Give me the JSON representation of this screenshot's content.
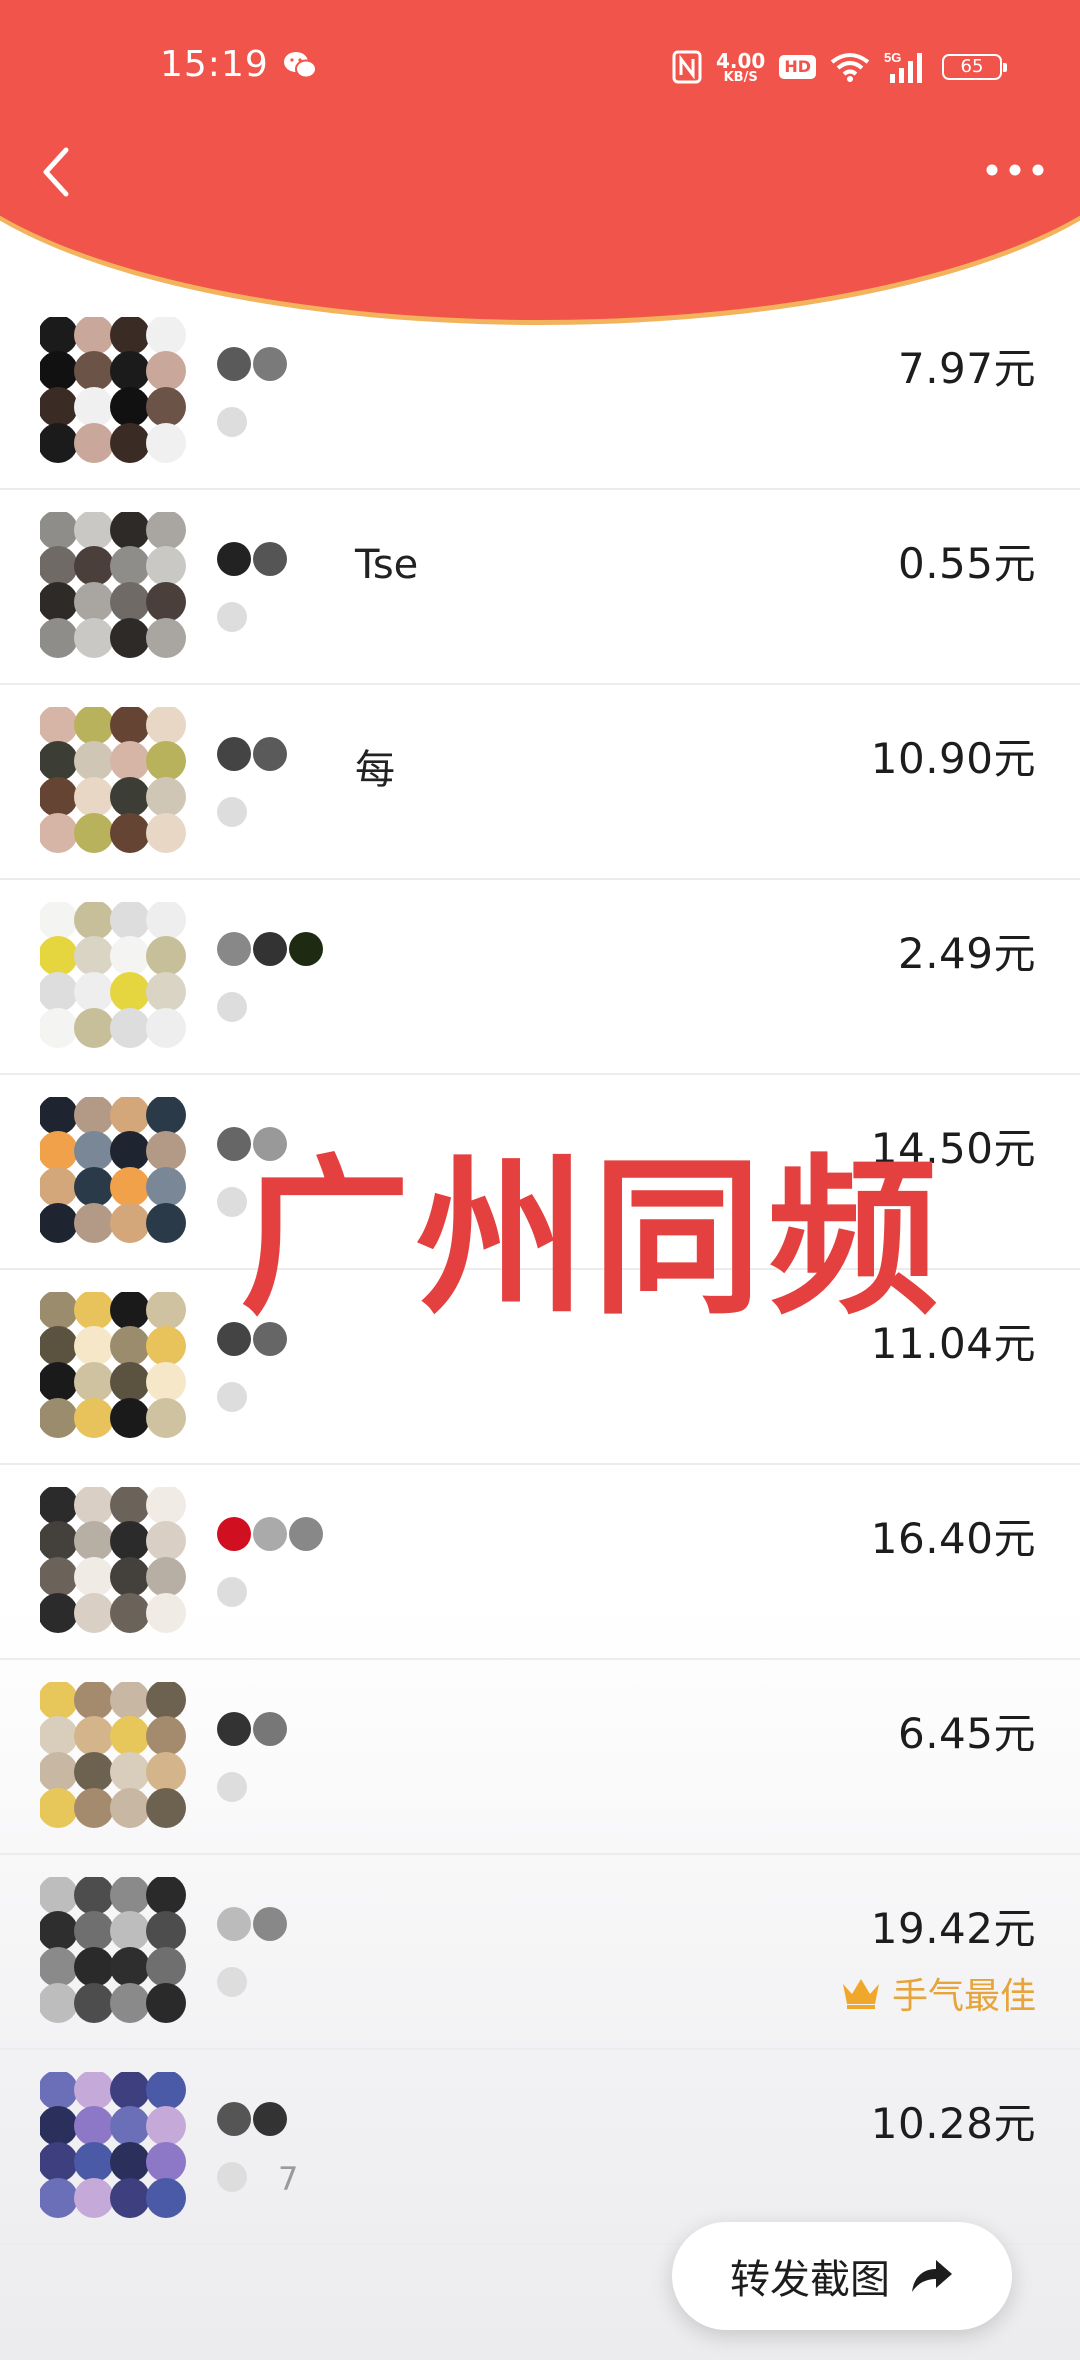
{
  "status_bar": {
    "time": "15:19",
    "network_speed": "4.00",
    "network_speed_unit": "KB/S",
    "hd_badge": "HD",
    "network_type": "5G",
    "battery": "65"
  },
  "colors": {
    "header_red": "#f1544a",
    "header_edge": "#f3b25c",
    "watermark": "#e4403f",
    "best_luck": "#e6a43a"
  },
  "watermark_text": "广州同频",
  "rows": [
    {
      "name": "",
      "amount": "7.97元"
    },
    {
      "name": "Tse",
      "amount": "0.55元"
    },
    {
      "name": "每",
      "amount": "10.90元"
    },
    {
      "name": "",
      "amount": "2.49元"
    },
    {
      "name": "",
      "amount": "14.50元"
    },
    {
      "name": "",
      "amount": "11.04元"
    },
    {
      "name": "",
      "amount": "16.40元"
    },
    {
      "name": "",
      "amount": "6.45元"
    },
    {
      "name": "",
      "amount": "19.42元",
      "badge": "手气最佳"
    },
    {
      "name": "7",
      "amount": "10.28元"
    }
  ],
  "share_button": {
    "label": "转发截图",
    "icon": "share-arrow-icon"
  }
}
